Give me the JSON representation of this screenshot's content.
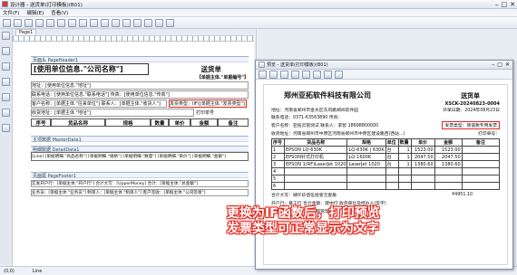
{
  "window": {
    "title": "设计器 - 送货单(打印模板)(B01)"
  },
  "menu": [
    "文件(F)",
    "编辑(E)",
    "查看(V)"
  ],
  "designer": {
    "tab": "Page1",
    "bands": {
      "page_header": "页面头 PageHeader1",
      "master": "主项数据 MasterData1",
      "detail": "明细数据 DetailData1",
      "footer": "页面尾 PageFooter1"
    },
    "company_field": "[使用单位信息.\"公司名称\"]",
    "title": "送货单",
    "number_field": "【单据主体.\"单据编号\"】",
    "address_line": "地址：[使用单位信息.\"地址\"]",
    "contact_line": "联系电话：[使用单位信息.\"联系电话\"]   传真：[使用单位信息.\"传真\"]",
    "customer_line": "客户名称：[单据主体.\"往来单位\"]   联系人：[单据主体.\"收货人\"]",
    "receive_line": "收货地址：[单据主体.\"地址\"]",
    "receipt_type": "发票类型：IIF([单据主体.\"发票类型\"]",
    "print_label": "打印单号",
    "table_headers": [
      "序号",
      "货品名称",
      "规格",
      "数量",
      "单价",
      "金额",
      "备注"
    ],
    "detail_row": "[Line]   [单据明细.\"商品名称\"]   [单据明细.\"规格\"]   [单据明细.\"数量\"]   [单据明细.\"单价\"]   [单据明细.\"金额\"]",
    "footer_line1": "实发开户行：[单据主体.\"开户行\"]   合计大写：[UpperMoney]   合计：[单据主体.\"总金额\"]",
    "footer_line2": "业务员：[单据主体.\"业务员\"]   制单人：[单据主体.\"制单人\"]   客户签收：[单据主体.\"公司签章\"]"
  },
  "preview": {
    "title": "预览 - 送货单(打印模板)(B01)",
    "company": "郑州亚拓软件科技有限公司",
    "doc_title": "送货单",
    "doc_no": "XSCK-20240823-0004",
    "address": "地址：河南省郑州市金水区东风路郑州软件园",
    "phone": "联系电话：0371-63563890   传真：",
    "date": "开单日期：2024年08月23日",
    "customer": "客户名称：亚拓云管测试   联系人：李智   18698800000",
    "receive": "收货地址：河南省郑州市中原区河南省郑州市中原区建设路西(西站...)",
    "receipt_type": "发票类型：增值税专用发票",
    "print_no": "打印单号：",
    "table_headers": [
      "序号",
      "货品名称",
      "规格",
      "单位",
      "数量",
      "单价",
      "金额",
      "备注"
    ],
    "rows": [
      [
        "1",
        "EPSON LQ-630K",
        "LQ-630K | 630K",
        "台",
        "1",
        "1523.00",
        "1523.00",
        ""
      ],
      [
        "2",
        "EPSON针式打印机",
        "LQ-1600K",
        "台",
        "1",
        "2047.50",
        "2047.50",
        ""
      ],
      [
        "3",
        "EPSON 1(RF)LaserJet 1020",
        "LaserJet 1020",
        "台",
        "1",
        "1380.60",
        "1380.60",
        ""
      ],
      [
        "4",
        "",
        "",
        "",
        "",
        "",
        "",
        ""
      ],
      [
        "5",
        "",
        "",
        "",
        "",
        "",
        "",
        ""
      ],
      [
        "6",
        "",
        "",
        "",
        "",
        "",
        "",
        ""
      ]
    ],
    "foot1": "合计大写：肆仟玖佰伍拾壹元壹角",
    "foot_total": "¥4951.10",
    "foot2": "开户行：基工行   合计金额：建中行 收货单位及经办人(签字)",
    "foot3": "业务员：本   制单人：系统管理员"
  },
  "callout": {
    "line1": "更换为IF函数后，打印预览",
    "line2": "发票类型可正常显示为文字"
  },
  "status": {
    "left": "(0,0)",
    "mid": "Line"
  },
  "colors": {
    "accent": "#e3261c"
  }
}
